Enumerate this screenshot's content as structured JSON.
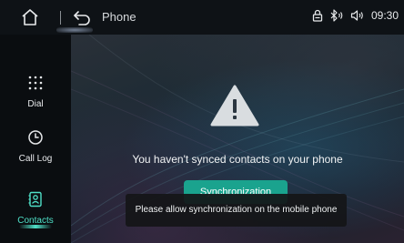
{
  "header": {
    "title": "Phone",
    "clock": "09:30",
    "icons": [
      "home-icon",
      "back-icon",
      "lock-icon",
      "bluetooth-icon",
      "volume-icon"
    ]
  },
  "sidebar": {
    "items": [
      {
        "label": "Dial",
        "icon": "dialpad-icon",
        "active": false
      },
      {
        "label": "Call Log",
        "icon": "clock-icon",
        "active": false
      },
      {
        "label": "Contacts",
        "icon": "contacts-icon",
        "active": true
      }
    ]
  },
  "main": {
    "warning_icon": "warning-icon",
    "message": "You haven't synced contacts on your phone",
    "sync_button": "Synchronization",
    "toast": "Please allow synchronization on the mobile phone"
  },
  "colors": {
    "accent": "#4fe0c8",
    "button": "#1aa38e",
    "background": "#0c1014"
  }
}
